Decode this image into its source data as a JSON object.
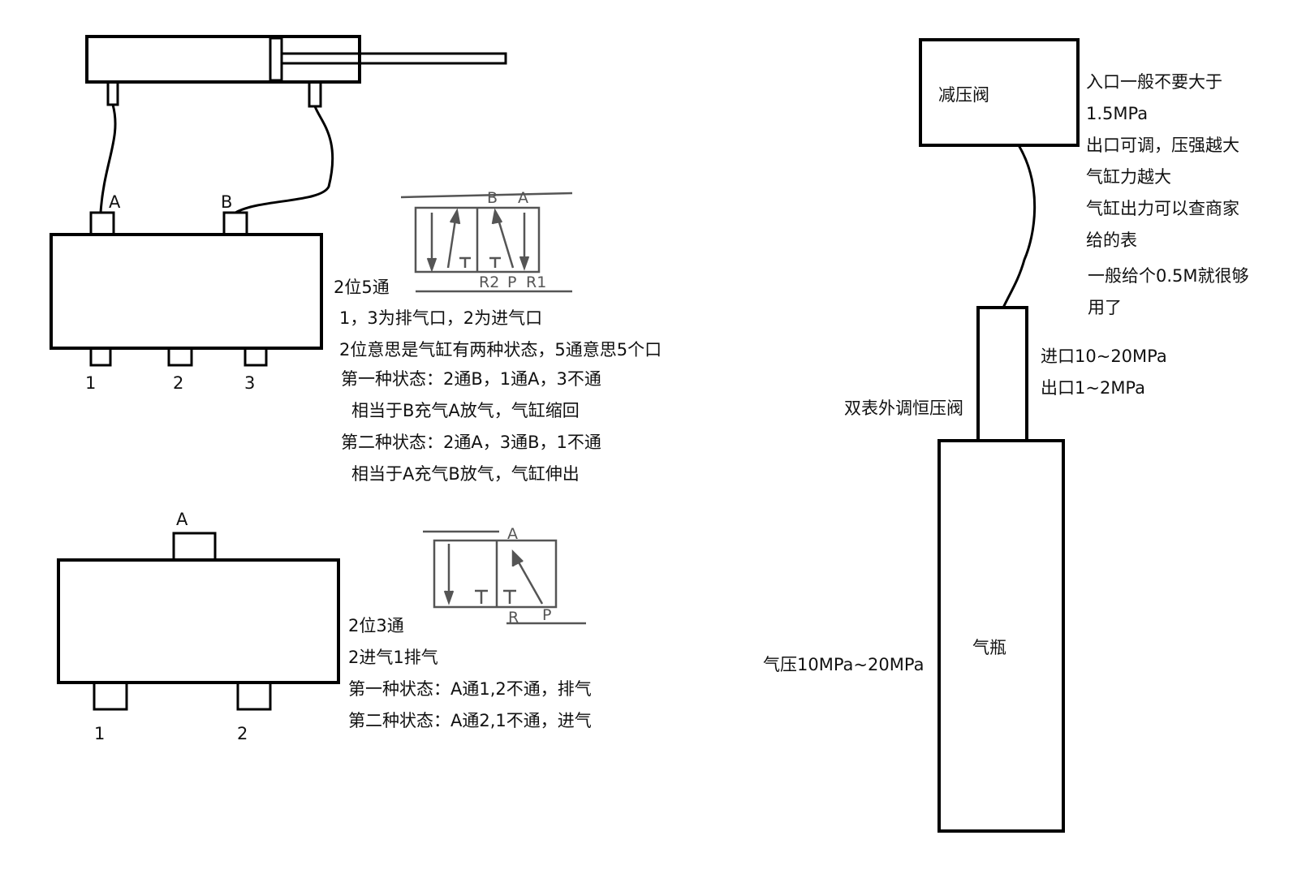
{
  "valve5": {
    "port_a": "A",
    "port_b": "B",
    "port_1": "1",
    "port_2": "2",
    "port_3": "3",
    "symbol": {
      "b": "B",
      "a": "A",
      "r2": "R2",
      "p": "P",
      "r1": "R1"
    },
    "title": "2位5通",
    "notes": [
      "1，3为排气口，2为进气口",
      "2位意思是气缸有两种状态，5通意思5个口",
      "第一种状态：2通B，1通A，3不通",
      "相当于B充气A放气，气缸缩回",
      "第二种状态：2通A，3通B，1不通",
      "相当于A充气B放气，气缸伸出"
    ]
  },
  "valve3": {
    "port_a": "A",
    "port_1": "1",
    "port_2": "2",
    "symbol": {
      "a": "A",
      "r": "R",
      "p": "P"
    },
    "title": "2位3通",
    "notes": [
      "2进气1排气",
      "第一种状态：A通1,2不通，排气",
      "第二种状态：A通2,1不通，进气"
    ]
  },
  "supply": {
    "reducer_label": "减压阀",
    "reducer_notes": [
      "入口一般不要大于",
      "1.5MPa",
      "出口可调，压强越大",
      "气缸力越大",
      "气缸出力可以查商家",
      "给的表",
      "一般给个0.5M就很够",
      "用了"
    ],
    "regulator_label": "双表外调恒压阀",
    "regulator_notes": [
      "进口10~20MPa",
      "出口1~2MPa"
    ],
    "bottle_label": "气瓶",
    "bottle_pressure": "气压10MPa~20MPa"
  }
}
